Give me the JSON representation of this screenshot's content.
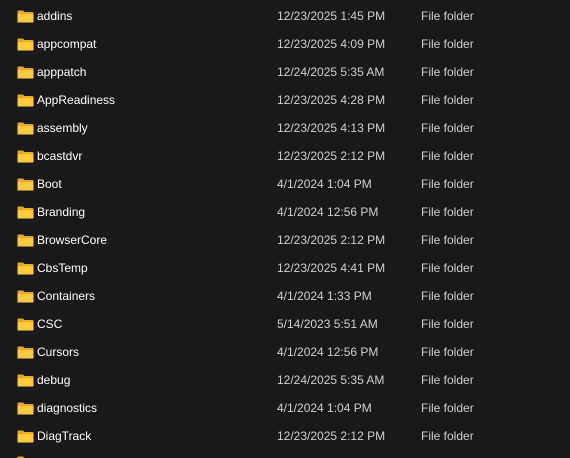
{
  "folder_icon": "folder-icon",
  "colors": {
    "background": "#191919",
    "name_text": "#ffffff",
    "meta_text": "#cfcfcf",
    "folder_back": "#e8a91f",
    "folder_front": "#ffcb3d"
  },
  "files": [
    {
      "name": "addins",
      "date": "12/23/2025 1:45 PM",
      "type": "File folder"
    },
    {
      "name": "appcompat",
      "date": "12/23/2025 4:09 PM",
      "type": "File folder"
    },
    {
      "name": "apppatch",
      "date": "12/24/2025 5:35 AM",
      "type": "File folder"
    },
    {
      "name": "AppReadiness",
      "date": "12/23/2025 4:28 PM",
      "type": "File folder"
    },
    {
      "name": "assembly",
      "date": "12/23/2025 4:13 PM",
      "type": "File folder"
    },
    {
      "name": "bcastdvr",
      "date": "12/23/2025 2:12 PM",
      "type": "File folder"
    },
    {
      "name": "Boot",
      "date": "4/1/2024 1:04 PM",
      "type": "File folder"
    },
    {
      "name": "Branding",
      "date": "4/1/2024 12:56 PM",
      "type": "File folder"
    },
    {
      "name": "BrowserCore",
      "date": "12/23/2025 2:12 PM",
      "type": "File folder"
    },
    {
      "name": "CbsTemp",
      "date": "12/23/2025 4:41 PM",
      "type": "File folder"
    },
    {
      "name": "Containers",
      "date": "4/1/2024 1:33 PM",
      "type": "File folder"
    },
    {
      "name": "CSC",
      "date": "5/14/2023 5:51 AM",
      "type": "File folder"
    },
    {
      "name": "Cursors",
      "date": "4/1/2024 12:56 PM",
      "type": "File folder"
    },
    {
      "name": "debug",
      "date": "12/24/2025 5:35 AM",
      "type": "File folder"
    },
    {
      "name": "diagnostics",
      "date": "4/1/2024 1:04 PM",
      "type": "File folder"
    },
    {
      "name": "DiagTrack",
      "date": "12/23/2025 2:12 PM",
      "type": "File folder"
    }
  ]
}
